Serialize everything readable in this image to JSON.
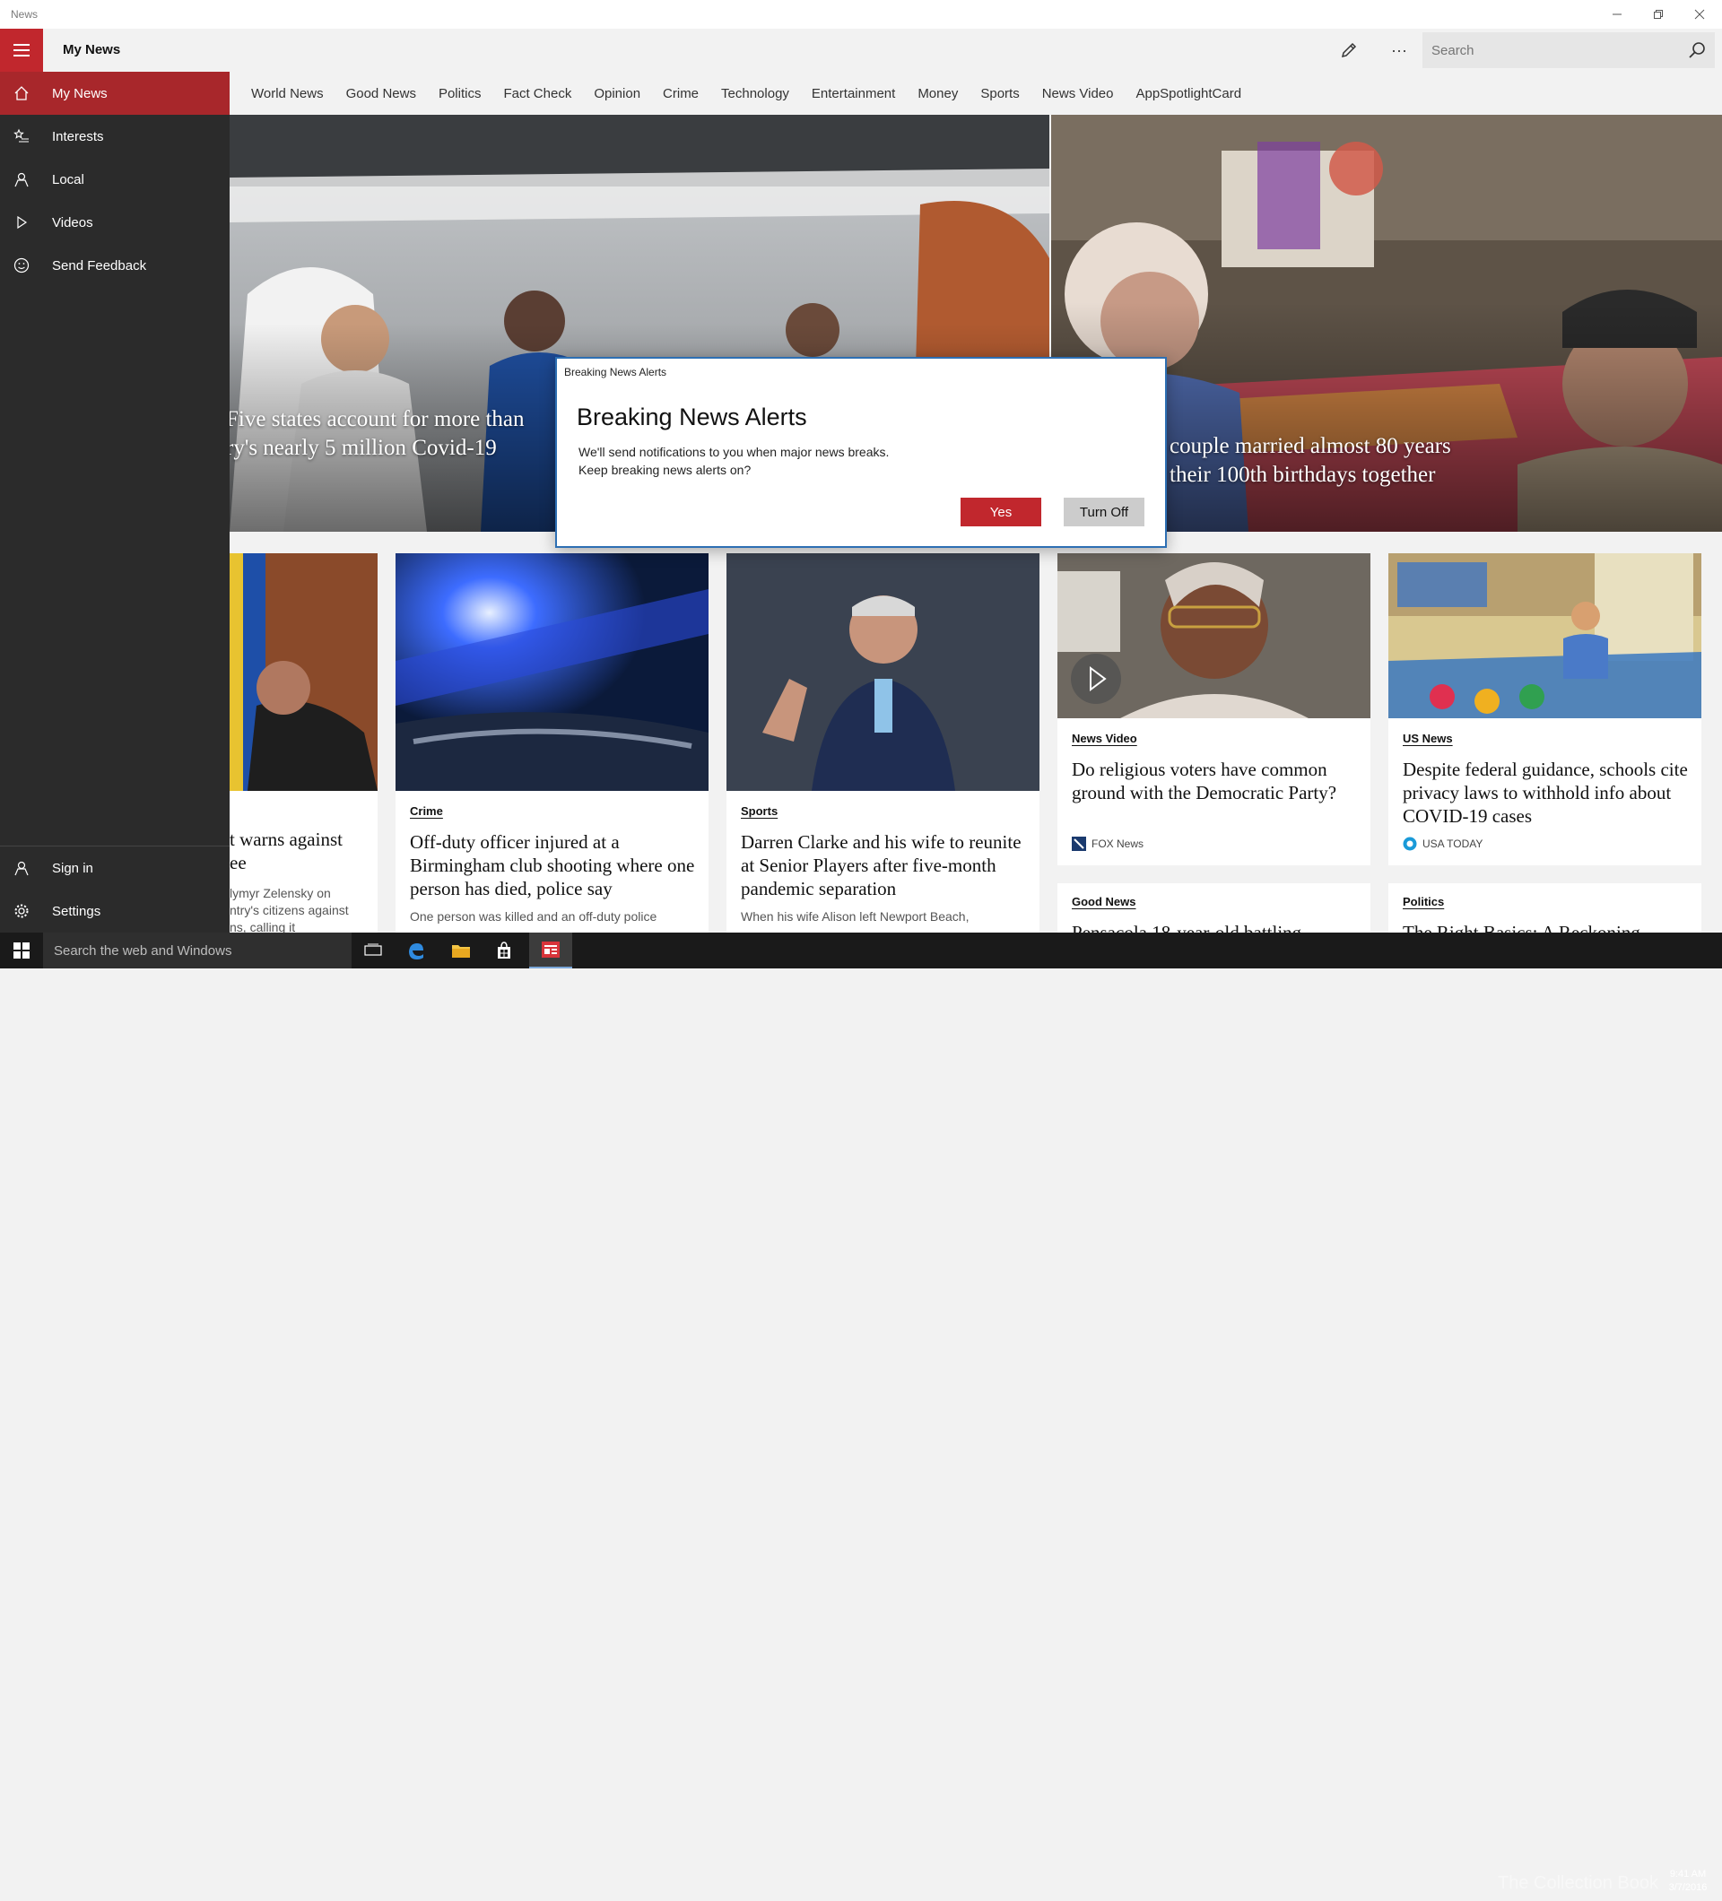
{
  "window": {
    "title": "News"
  },
  "appbar": {
    "title": "My News",
    "search_placeholder": "Search",
    "more_label": "···"
  },
  "sidebar": {
    "items": [
      {
        "label": "My News"
      },
      {
        "label": "Interests"
      },
      {
        "label": "Local"
      },
      {
        "label": "Videos"
      },
      {
        "label": "Send Feedback"
      }
    ],
    "bottom": [
      {
        "label": "Sign in"
      },
      {
        "label": "Settings"
      }
    ]
  },
  "tabs": [
    "World News",
    "Good News",
    "Politics",
    "Fact Check",
    "Opinion",
    "Crime",
    "Technology",
    "Entertainment",
    "Money",
    "Sports",
    "News Video",
    "AppSpotlightCard"
  ],
  "hero": [
    {
      "title_line1": "Five states account for more than",
      "title_line2": "ry's nearly 5 million Covid-19"
    },
    {
      "title_line1": "couple married almost 80 years",
      "title_line2": "their 100th birthdays together"
    }
  ],
  "cards": [
    {
      "headline": "t warns against\nee",
      "summary": "lymyr Zelensky on\nntry's citizens against\nns, calling it"
    },
    {
      "category": "Crime",
      "headline": "Off-duty officer injured at a Birmingham club shooting where one person has died, police say",
      "summary": "One person was killed and an off-duty police"
    },
    {
      "category": "Sports",
      "headline": "Darren Clarke and his wife to reunite at Senior Players after five-month pandemic separation",
      "summary": "When his wife Alison left Newport Beach,"
    },
    {
      "category": "News Video",
      "headline": "Do religious voters have common ground with the Democratic Party?",
      "source": "FOX News"
    },
    {
      "category": "US News",
      "headline": "Despite federal guidance, schools cite privacy laws to withhold info about COVID-19 cases",
      "source": "USA TODAY"
    },
    {
      "category": "Good News",
      "headline": "Pensacola 18-year-old battling"
    },
    {
      "category": "Politics",
      "headline": "The Right Basics: A Reckoning"
    }
  ],
  "dialog": {
    "caption": "Breaking News Alerts",
    "title": "Breaking News Alerts",
    "message_line1": "We'll send notifications to you when major news breaks.",
    "message_line2": "Keep breaking news alerts on?",
    "yes_label": "Yes",
    "off_label": "Turn Off"
  },
  "taskbar": {
    "search_placeholder": "Search the web and Windows",
    "watermark": "The Collection Book",
    "time": "9:41 AM",
    "date": "3/7/2016"
  },
  "colors": {
    "accent": "#c1272d",
    "sidebar": "#2b2b2b",
    "sidebar_active": "#a8272b",
    "dialog_border": "#2d6fb3"
  },
  "icons": [
    "hamburger-icon",
    "pencil-icon",
    "more-icon",
    "search-icon",
    "home-icon",
    "star-list-icon",
    "person-icon",
    "play-icon",
    "smiley-icon",
    "settings-gear-icon",
    "windows-logo-icon",
    "task-view-icon",
    "edge-icon",
    "file-explorer-icon",
    "store-icon",
    "news-app-icon"
  ]
}
